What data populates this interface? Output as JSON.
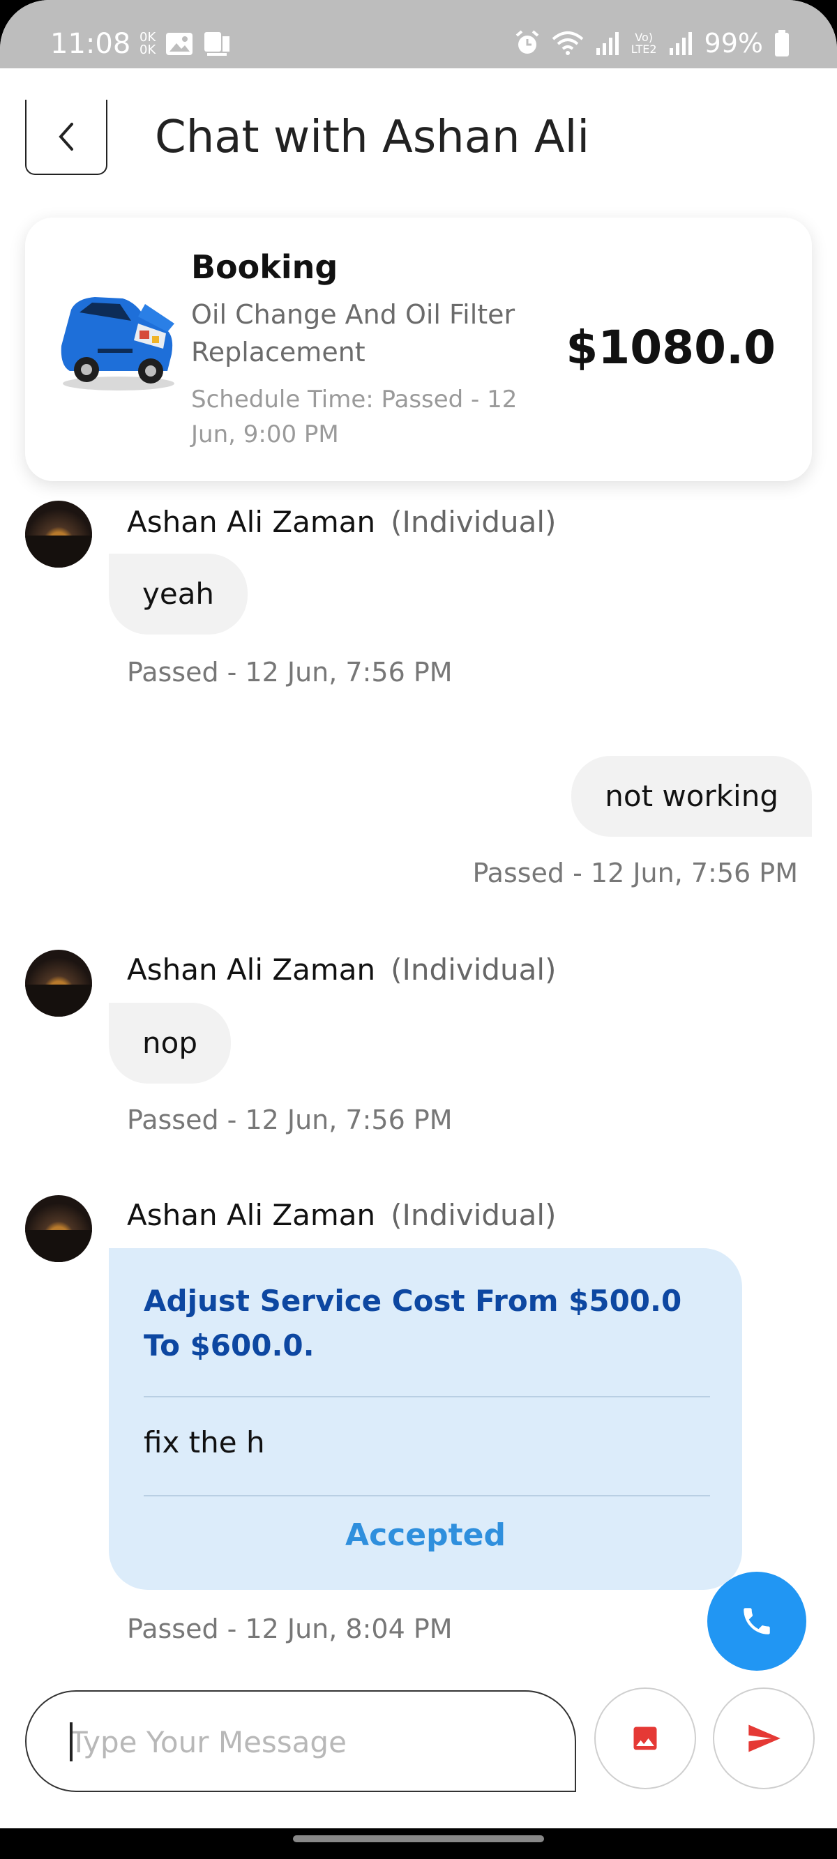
{
  "status_bar": {
    "time": "11:08",
    "battery": "99%"
  },
  "header": {
    "title": "Chat with Ashan Ali"
  },
  "booking": {
    "heading": "Booking",
    "service": "Oil Change And Oil Filter Replacement",
    "schedule": "Schedule Time: Passed -  12 Jun, 9:00 PM",
    "price": "$1080.0"
  },
  "messages": [
    {
      "sender": "Ashan Ali Zaman",
      "kind": "(Individual)",
      "text": "yeah",
      "time": "Passed -  12 Jun, 7:56 PM"
    },
    {
      "text": "not working",
      "time": "Passed -  12 Jun, 7:56 PM"
    },
    {
      "sender": "Ashan Ali Zaman",
      "kind": "(Individual)",
      "text": "nop",
      "time": "Passed -  12 Jun, 7:56 PM"
    },
    {
      "sender": "Ashan Ali Zaman",
      "kind": "(Individual)",
      "time": "Passed -  12 Jun, 8:04 PM"
    }
  ],
  "offer": {
    "title": "Adjust Service Cost From $500.0 To $600.0.",
    "note": "fix the h",
    "status": "Accepted"
  },
  "composer": {
    "placeholder": "Type Your Message"
  },
  "colors": {
    "primary_blue": "#2196f3",
    "offer_bg": "#dcecfa",
    "offer_title": "#0d47a1",
    "accent_red": "#e53935"
  }
}
